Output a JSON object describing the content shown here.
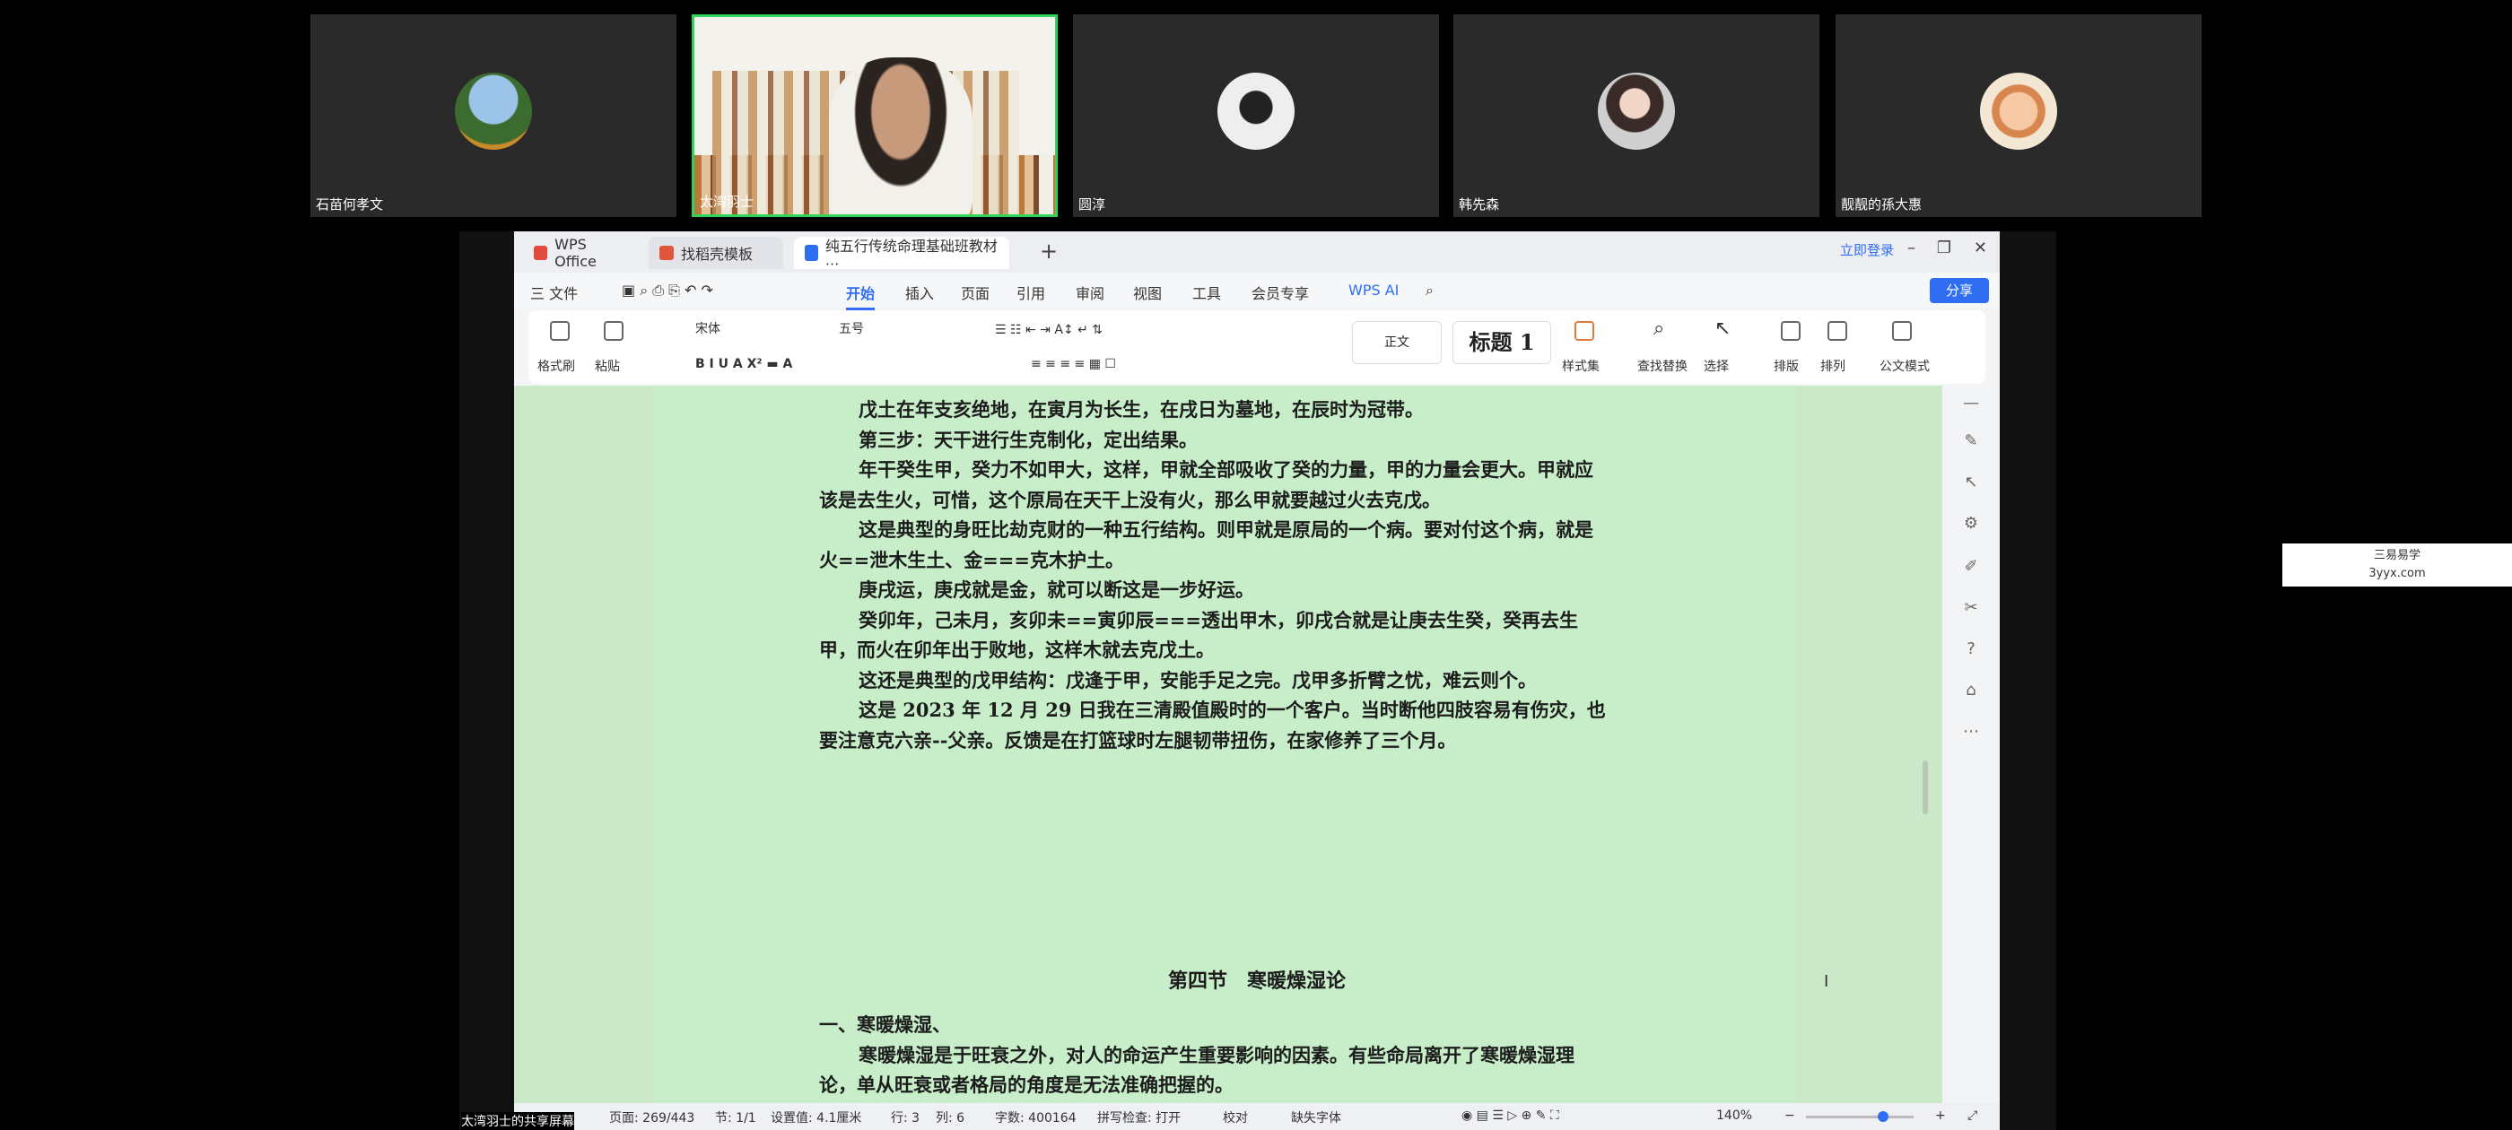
{
  "participants": [
    {
      "name": "石苗何孝文",
      "avatar": "landscape"
    },
    {
      "name": "太湾羽士",
      "avatar": "camera"
    },
    {
      "name": "圆淳",
      "avatar": "portrait"
    },
    {
      "name": "韩先森",
      "avatar": "portrait"
    },
    {
      "name": "靓靓的孫大惠",
      "avatar": "cartoon"
    }
  ],
  "window": {
    "tabs": [
      "WPS Office",
      "找稻壳模板",
      "纯五行传统命理基础班教材···"
    ],
    "login": "立即登录"
  },
  "menu": {
    "file": "三 文件",
    "items": [
      "开始",
      "插入",
      "页面",
      "引用",
      "审阅",
      "视图",
      "工具",
      "会员专享"
    ],
    "active": "开始",
    "wpsai": "WPS AI",
    "share": "分享"
  },
  "ribbon": {
    "format_painter": "格式刷",
    "paste": "粘贴",
    "font": "宋体",
    "size": "五号",
    "style_normal": "正文",
    "style_heading": "标题 1",
    "style_set": "样式集",
    "find_replace": "查找替换",
    "select": "选择",
    "layout": "排版",
    "arrange": "排列",
    "official": "公文模式"
  },
  "document": {
    "paragraphs": [
      {
        "indent": true,
        "text": "戊土在年支亥绝地，在寅月为长生，在戌日为墓地，在辰时为冠带。"
      },
      {
        "indent": true,
        "text": "第三步：天干进行生克制化，定出结果。"
      },
      {
        "indent": true,
        "text": "年干癸生甲，癸力不如甲大，这样，甲就全部吸收了癸的力量，甲的力量会更大。甲就应该是去生火，可惜，这个原局在天干上没有火，那么甲就要越过火去克戊。"
      },
      {
        "indent": true,
        "text": "这是典型的身旺比劫克财的一种五行结构。则甲就是原局的一个病。要对付这个病，就是火==泄木生土、金===克木护土。"
      },
      {
        "indent": true,
        "text": "庚戌运，庚戌就是金，就可以断这是一步好运。"
      },
      {
        "indent": true,
        "text": "癸卯年，己未月，亥卯未==寅卯辰===透出甲木，卯戌合就是让庚去生癸，癸再去生甲，而火在卯年出于败地，这样木就去克戊土。"
      },
      {
        "indent": true,
        "text": "这还是典型的戊甲结构：戊逢于甲，安能手足之完。戊甲多折臂之忧，难云则个。"
      },
      {
        "indent": true,
        "text": "这是 2023 年 12 月 29 日我在三清殿值殿时的一个客户。当时断他四肢容易有伤灾，也要注意克六亲--父亲。反馈是在打篮球时左腿韧带扭伤，在家修养了三个月。"
      }
    ],
    "section_heading": "第四节　寒暖燥湿论",
    "section_paragraphs": [
      {
        "indent": false,
        "text": "一、寒暖燥湿、"
      },
      {
        "indent": true,
        "text": "寒暖燥湿是于旺衰之外，对人的命运产生重要影响的因素。有些命局离开了寒暖燥湿理论，单从旺衰或者格局的角度是无法准确把握的。"
      }
    ]
  },
  "status": {
    "page": "页面: 269/443",
    "section": "节: 1/1",
    "setting": "设置值: 4.1厘米",
    "row": "行: 3",
    "col": "列: 6",
    "words": "字数: 400164",
    "spell": "拼写检查: 打开",
    "proof": "校对",
    "missing_font": "缺失字体",
    "zoom": "140%"
  },
  "presenter_label": "太湾羽士的共享屏幕",
  "watermark": {
    "line1": "三易易学",
    "line2": "3yyx.com"
  }
}
